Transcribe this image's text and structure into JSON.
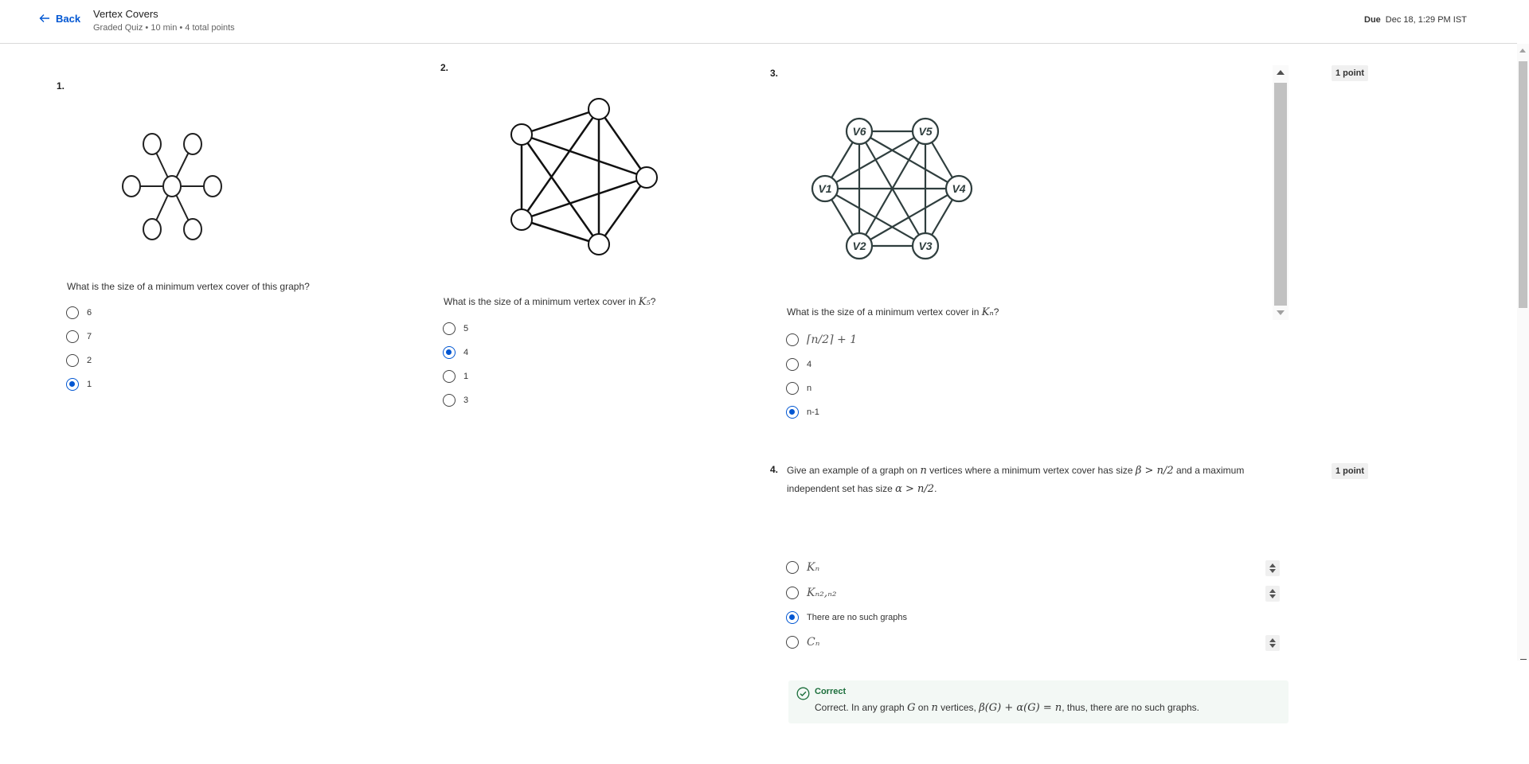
{
  "header": {
    "back_label": "Back",
    "title": "Vertex Covers",
    "meta": "Graded Quiz • 10 min • 4 total points",
    "due_label": "Due",
    "due_value": "Dec 18, 1:29 PM IST"
  },
  "questions": [
    {
      "number": "1.",
      "prompt": "What is the size of a minimum vertex cover of this graph?",
      "options": [
        "6",
        "7",
        "2",
        "1"
      ],
      "selected_index": 3,
      "graph": "star"
    },
    {
      "number": "2.",
      "prompt_before": "What is the size of a minimum vertex cover in ",
      "prompt_math": "K₅",
      "prompt_after": "?",
      "options": [
        "5",
        "4",
        "1",
        "3"
      ],
      "selected_index": 1,
      "graph": "K5"
    },
    {
      "number": "3.",
      "points": "1 point",
      "prompt_before": "What is the size of a minimum vertex cover in ",
      "prompt_math": "Kₙ",
      "prompt_after": "?",
      "options": [
        "⌈n/2⌉ + 1",
        "4",
        "n",
        "n-1"
      ],
      "selected_index": 3,
      "graph": "K6",
      "vertex_labels": [
        "V6",
        "V5",
        "V1",
        "V4",
        "V2",
        "V3"
      ]
    },
    {
      "number": "4.",
      "points": "1 point",
      "prompt_line1_a": "Give an example of a graph on ",
      "prompt_line1_m1": "n",
      "prompt_line1_b": " vertices where a minimum vertex cover has size ",
      "prompt_line1_m2": "β > n/2",
      "prompt_line1_c": " and a maximum",
      "prompt_line2_a": "independent set has size ",
      "prompt_line2_m": "α > n/2",
      "prompt_line2_b": ".",
      "options": [
        "Kₙ",
        "Kₙ₂,ₙ₂",
        "There are no such graphs",
        "Cₙ"
      ],
      "selected_index": 2
    }
  ],
  "feedback": {
    "title": "Correct",
    "text_a": "Correct. In any graph ",
    "m1": "G",
    "text_b": " on ",
    "m2": "n",
    "text_c": " vertices, ",
    "m3": "β(G) + α(G) = n",
    "text_d": ", thus, there are no such graphs."
  },
  "colors": {
    "accent": "#0056d2",
    "success": "#1b6e3b"
  }
}
